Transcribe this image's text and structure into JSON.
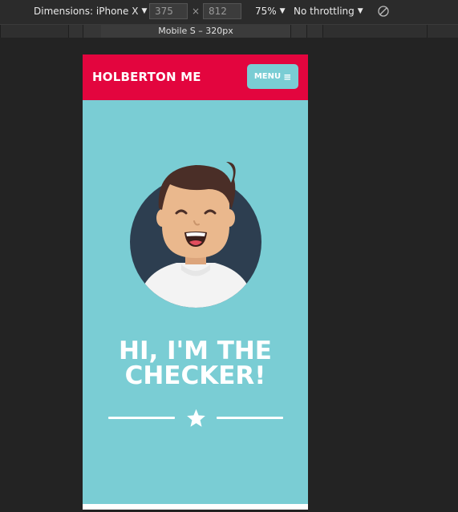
{
  "toolbar": {
    "dimensions_label": "Dimensions: iPhone X",
    "width_value": "375",
    "height_value": "812",
    "times_symbol": "×",
    "zoom": "75%",
    "throttling": "No throttling",
    "dropdown_caret": "▼"
  },
  "ruler": {
    "label": "Mobile S – 320px"
  },
  "page": {
    "brand": "HOLBERTON ME",
    "menu_label": "MENU",
    "menu_icon": "≡",
    "hero_line1": "HI, I'M THE",
    "hero_line2": "CHECKER!"
  },
  "colors": {
    "header_red": "#e3053e",
    "teal": "#7acdd4",
    "avatar_bg": "#2d3e50",
    "white": "#ffffff"
  },
  "icons": {
    "rotate": "rotate-icon",
    "menu": "hamburger-icon",
    "star": "star-icon"
  }
}
